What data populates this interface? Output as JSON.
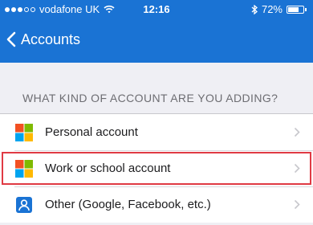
{
  "status_bar": {
    "carrier": "vodafone UK",
    "time": "12:16",
    "battery_percent": "72%",
    "battery_level": 0.72,
    "signal_bars_filled": 3,
    "signal_bars_total": 5
  },
  "nav": {
    "back_label": "Accounts"
  },
  "section": {
    "header": "WHAT KIND OF ACCOUNT ARE YOU ADDING?"
  },
  "accounts": [
    {
      "label": "Personal account",
      "icon": "microsoft-logo-icon"
    },
    {
      "label": "Work or school account",
      "icon": "microsoft-logo-icon",
      "highlighted": true
    },
    {
      "label": "Other (Google, Facebook, etc.)",
      "icon": "person-icon"
    }
  ],
  "colors": {
    "header": "#1a73d4",
    "highlight": "#e03a44",
    "ms_red": "#f25022",
    "ms_green": "#7fba00",
    "ms_blue": "#00a4ef",
    "ms_yellow": "#ffb900",
    "person_blue": "#1a73d4"
  }
}
